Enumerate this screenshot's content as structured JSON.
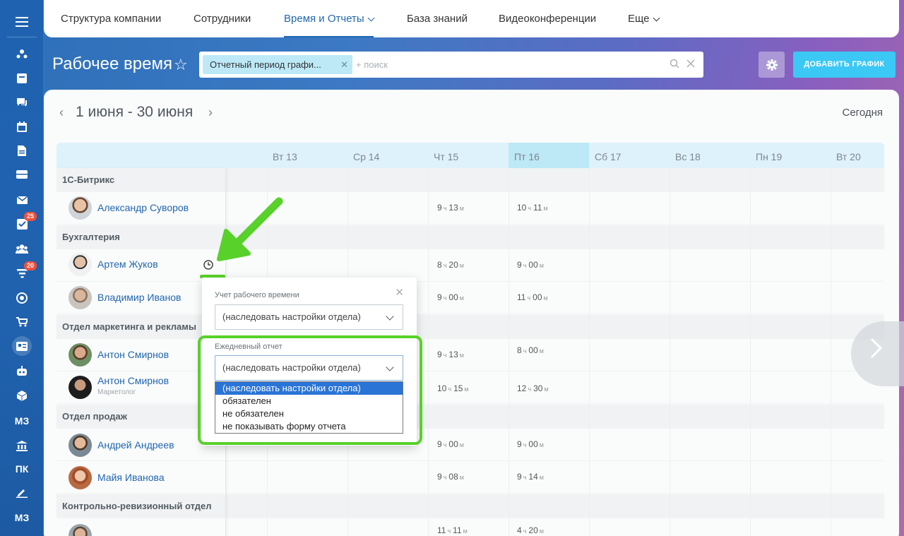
{
  "nav": {
    "items": [
      "Структура компании",
      "Сотрудники",
      "Время и Отчеты",
      "База знаний",
      "Видеоконференции",
      "Еще"
    ]
  },
  "sidebar": {
    "badge_tasks": "25",
    "badge_filter": "20",
    "text_items": [
      "МЗ",
      "ПК",
      "МЗ"
    ]
  },
  "header": {
    "title": "Рабочее время",
    "filter_chip": "Отчетный период графи...",
    "search_placeholder": "+ поиск",
    "add_button": "ДОБАВИТЬ ГРАФИК"
  },
  "period": {
    "label": "1 июня - 30 июня",
    "today": "Сегодня"
  },
  "days": [
    "Вт 13",
    "Ср 14",
    "Чт 15",
    "Пт 16",
    "Сб 17",
    "Вс 18",
    "Пн 19",
    "Вт 20"
  ],
  "units": {
    "h": "ч",
    "m": "м"
  },
  "groups": [
    {
      "dept": "1С-Битрикс"
    },
    {
      "dept": "Бухгалтерия"
    },
    {
      "dept": "Отдел маркетинга и рекламы"
    },
    {
      "dept": "Отдел продаж"
    },
    {
      "dept": "Контрольно-ревизионный отдел"
    }
  ],
  "users": [
    {
      "name": "Александр Суворов",
      "position": "",
      "thu_h": "9",
      "thu_m": "13",
      "fri_h": "10",
      "fri_m": "11"
    },
    {
      "name": "Артем Жуков",
      "position": "",
      "thu_h": "8",
      "thu_m": "20",
      "fri_h": "9",
      "fri_m": "00"
    },
    {
      "name": "Владимир Иванов",
      "position": "",
      "thu_h": "9",
      "thu_m": "00",
      "fri_h": "11",
      "fri_m": "00"
    },
    {
      "name": "Антон Смирнов",
      "position": "",
      "thu_h": "9",
      "thu_m": "13",
      "fri_h": "8",
      "fri_m": "00"
    },
    {
      "name": "Антон Смирнов",
      "position": "Маркетолог",
      "thu_h": "10",
      "thu_m": "15",
      "fri_h": "12",
      "fri_m": "30"
    },
    {
      "name": "Андрей Андреев",
      "position": "",
      "thu_h": "9",
      "thu_m": "00",
      "fri_h": "9",
      "fri_m": "00"
    },
    {
      "name": "Майя Иванова",
      "position": "",
      "thu_h": "9",
      "thu_m": "08",
      "fri_h": "9",
      "fri_m": "14"
    },
    {
      "name": "",
      "position": "",
      "thu_h": "11",
      "thu_m": "11",
      "fri_h": "4",
      "fri_m": "20"
    }
  ],
  "popup": {
    "label_time": "Учет рабочего времени",
    "value_time": "(наследовать настройки отдела)",
    "label_report": "Ежедневный отчет",
    "value_report": "(наследовать настройки отдела)",
    "options": [
      "(наследовать настройки отдела)",
      "обязателен",
      "не обязателен",
      "не показывать форму отчета"
    ]
  },
  "colors": {
    "accent": "#2067b0",
    "add_button": "#3bc8f5",
    "highlight": "#58d12a",
    "today_col": "#bde8f6"
  }
}
